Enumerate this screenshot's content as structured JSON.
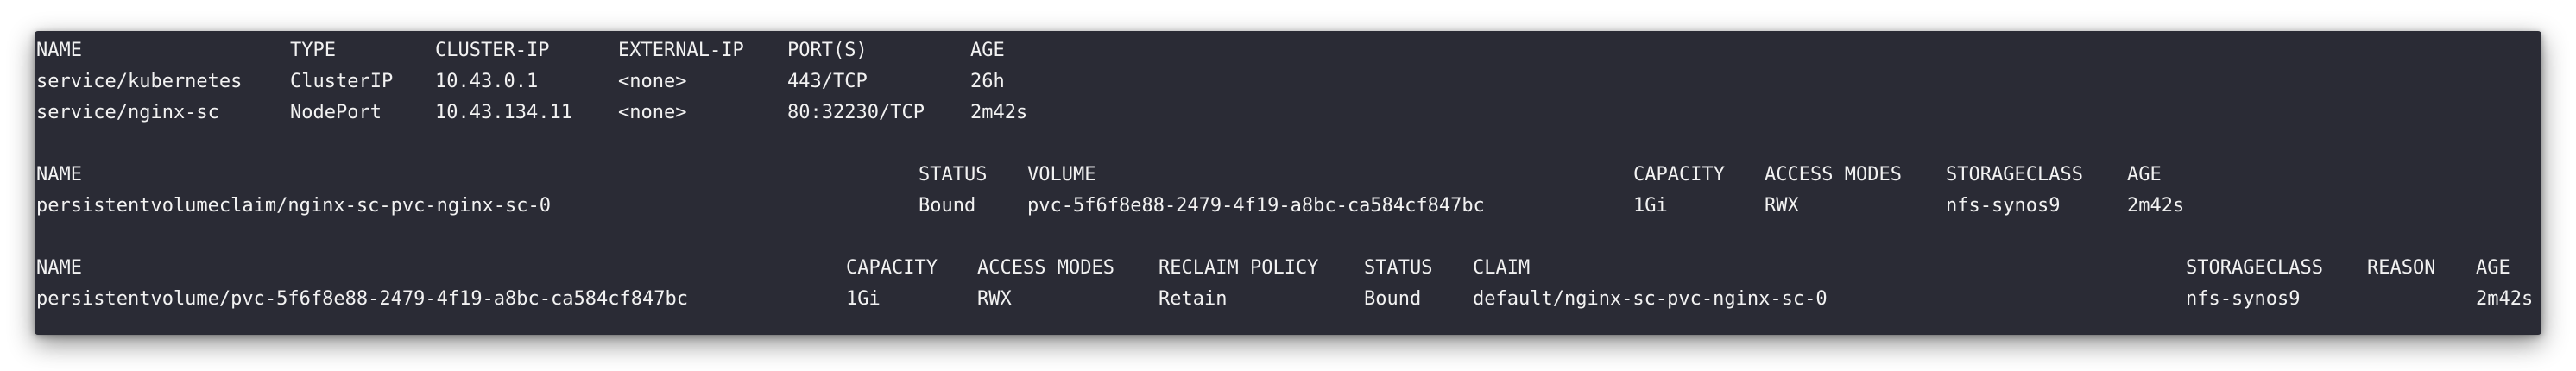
{
  "services": {
    "header": [
      "NAME",
      "TYPE",
      "CLUSTER-IP",
      "EXTERNAL-IP",
      "PORT(S)",
      "AGE"
    ],
    "rows": [
      [
        "service/kubernetes",
        "ClusterIP",
        "10.43.0.1",
        "<none>",
        "443/TCP",
        "26h"
      ],
      [
        "service/nginx-sc",
        "NodePort",
        "10.43.134.11",
        "<none>",
        "80:32230/TCP",
        "2m42s"
      ]
    ]
  },
  "pvc": {
    "header": [
      "NAME",
      "STATUS",
      "VOLUME",
      "CAPACITY",
      "ACCESS MODES",
      "STORAGECLASS",
      "AGE"
    ],
    "rows": [
      [
        "persistentvolumeclaim/nginx-sc-pvc-nginx-sc-0",
        "Bound",
        "pvc-5f6f8e88-2479-4f19-a8bc-ca584cf847bc",
        "1Gi",
        "RWX",
        "nfs-synos9",
        "2m42s"
      ]
    ]
  },
  "pv": {
    "header": [
      "NAME",
      "CAPACITY",
      "ACCESS MODES",
      "RECLAIM POLICY",
      "STATUS",
      "CLAIM",
      "STORAGECLASS",
      "REASON",
      "AGE"
    ],
    "rows": [
      [
        "persistentvolume/pvc-5f6f8e88-2479-4f19-a8bc-ca584cf847bc",
        "1Gi",
        "RWX",
        "Retain",
        "Bound",
        "default/nginx-sc-pvc-nginx-sc-0",
        "nfs-synos9",
        "",
        "2m42s"
      ]
    ]
  },
  "colors": {
    "terminal_bg": "#2a2b35",
    "text": "#f2f2f2"
  }
}
